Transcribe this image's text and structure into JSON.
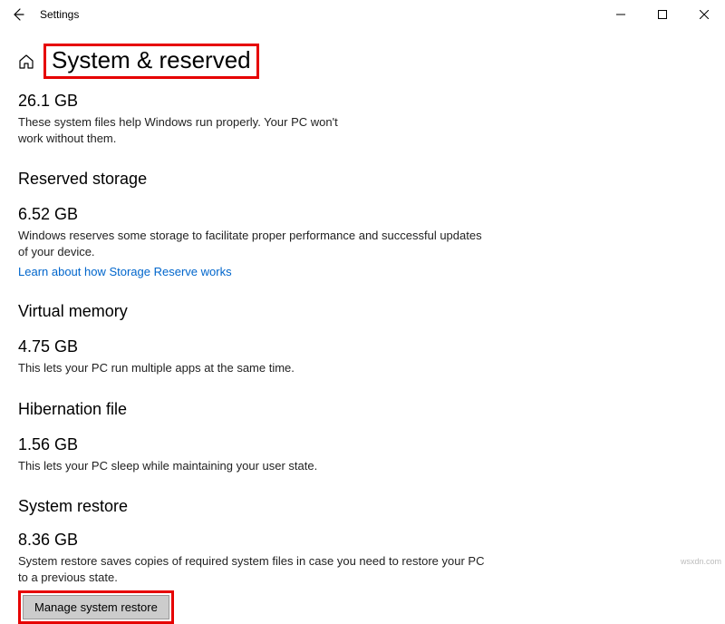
{
  "window": {
    "title": "Settings"
  },
  "page": {
    "title": "System & reserved"
  },
  "system_files": {
    "size": "26.1 GB",
    "desc": "These system files help Windows run properly. Your PC won't work without them."
  },
  "reserved_storage": {
    "heading": "Reserved storage",
    "size": "6.52 GB",
    "desc": "Windows reserves some storage to facilitate proper performance and successful updates of your device.",
    "link": "Learn about how Storage Reserve works"
  },
  "virtual_memory": {
    "heading": "Virtual memory",
    "size": "4.75 GB",
    "desc": "This lets your PC run multiple apps at the same time."
  },
  "hibernation": {
    "heading": "Hibernation file",
    "size": "1.56 GB",
    "desc": "This lets your PC sleep while maintaining your user state."
  },
  "system_restore": {
    "heading": "System restore",
    "size": "8.36 GB",
    "desc": "System restore saves copies of required system files in case you need to restore your PC to a previous state.",
    "button": "Manage system restore"
  },
  "watermark": "wsxdn.com"
}
